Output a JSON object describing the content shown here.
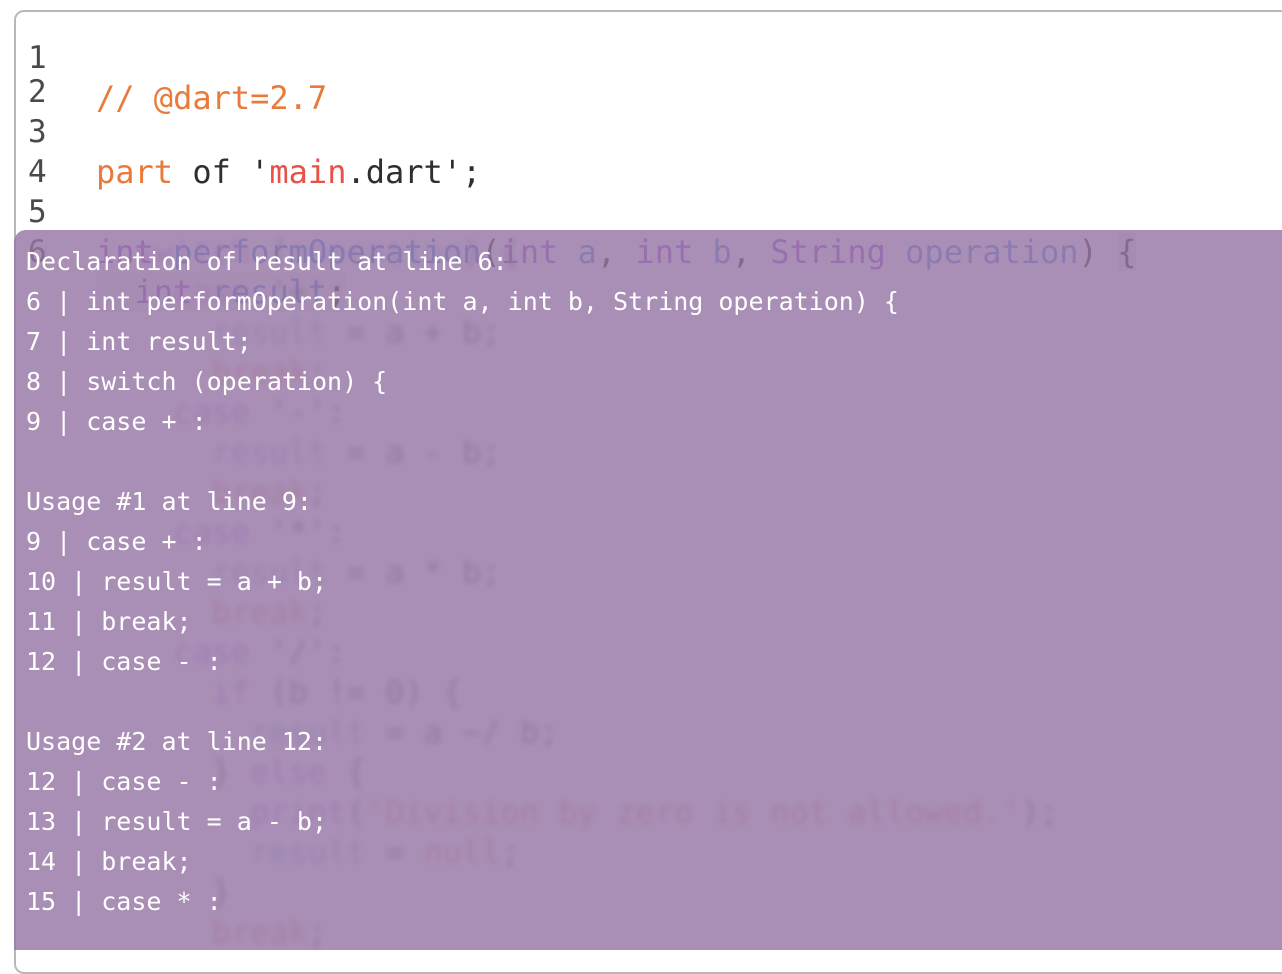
{
  "editor": {
    "lines": [
      {
        "num": "1",
        "text": "// @dart=2.7"
      },
      {
        "num": "2",
        "text": ""
      },
      {
        "num": "3",
        "text": "part of 'main.dart';"
      },
      {
        "num": "4",
        "text": ""
      },
      {
        "num": "5",
        "text": "int performOperation(int a, int b, String operation) {"
      },
      {
        "num": "6",
        "text": "  int result;"
      }
    ]
  },
  "overlay": {
    "lines": [
      "Declaration of result at line 6:",
      "6 | int performOperation(int a, int b, String operation) {",
      "7 | int result;",
      "8 | switch (operation) {",
      "9 | case + :",
      "",
      "Usage #1 at line 9:",
      "9 | case + :",
      "10 | result = a + b;",
      "11 | break;",
      "12 | case - :",
      "",
      "Usage #2 at line 12:",
      "12 | case - :",
      "13 | result = a - b;",
      "14 | break;",
      "15 | case * :"
    ]
  },
  "colors": {
    "overlay_bg": "#9676a5",
    "keyword": "#a94ee4",
    "function": "#4d8be6",
    "string": "#e75147",
    "comment": "#ea7a39"
  }
}
